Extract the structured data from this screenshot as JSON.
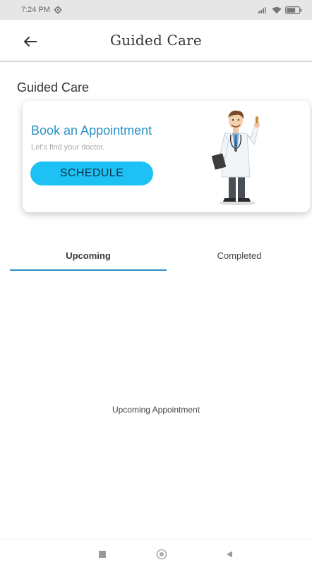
{
  "status_bar": {
    "time": "7:24 PM",
    "icons": [
      "gear-icon",
      "signal-icon",
      "wifi-icon",
      "battery-icon"
    ]
  },
  "app_bar": {
    "title": "Guided Care",
    "back_icon": "arrow-left-icon"
  },
  "section": {
    "title": "Guided Care"
  },
  "card": {
    "title": "Book an Appointment",
    "subtitle": "Let's find your doctor.",
    "button_label": "SCHEDULE",
    "illustration": "doctor-illustration"
  },
  "tabs": [
    {
      "label": "Upcoming",
      "selected": true
    },
    {
      "label": "Completed",
      "selected": false
    }
  ],
  "empty_state": {
    "text": "Upcoming Appointment"
  },
  "nav_bar": {
    "icons": [
      "recents-icon",
      "home-icon",
      "back-triangle-icon"
    ]
  },
  "colors": {
    "accent": "#2a91c6",
    "button": "#1dc1f4",
    "status_bar": "#e6e6e6"
  }
}
